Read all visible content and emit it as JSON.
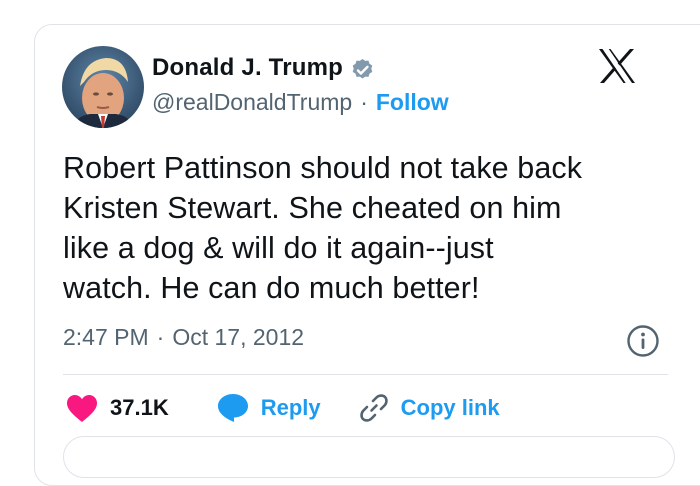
{
  "author": {
    "name": "Donald J. Trump",
    "handle": "@realDonaldTrump",
    "separator": "·",
    "follow_label": "Follow"
  },
  "tweet": {
    "lines": [
      "Robert Pattinson should not take back",
      "Kristen Stewart. She cheated on him",
      "like a dog & will do it again--just",
      "watch. He can do much better!"
    ],
    "time": "2:47 PM",
    "separator": "·",
    "date": "Oct 17, 2012"
  },
  "actions": {
    "likes_count": "37.1K",
    "reply_label": "Reply",
    "copy_link_label": "Copy link"
  },
  "icons": {
    "logo": "x-logo-icon",
    "verified": "verified-badge-icon",
    "info": "info-icon",
    "like": "heart-icon",
    "reply": "speech-bubble-icon",
    "copy": "link-icon"
  },
  "colors": {
    "accent": "#1d9bf0",
    "like": "#f91880",
    "text": "#0f1419",
    "secondary": "#536471",
    "border": "#dfe3e8",
    "verified_badge": "#829aab"
  }
}
